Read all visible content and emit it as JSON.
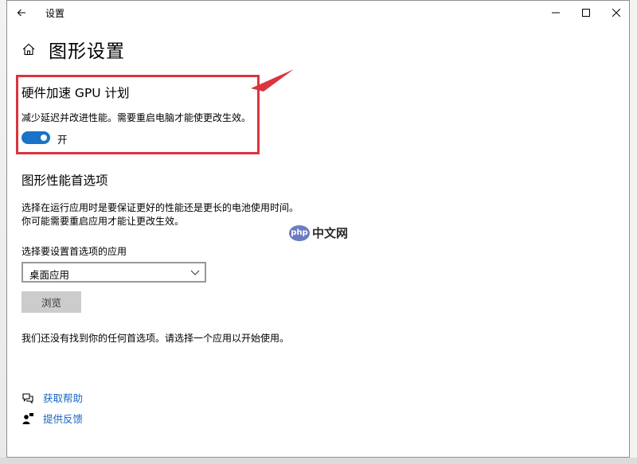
{
  "window": {
    "title": "设置"
  },
  "page": {
    "title": "图形设置"
  },
  "gpu_scheduling": {
    "heading": "硬件加速 GPU 计划",
    "description": "减少延迟并改进性能。需要重启电脑才能使更改生效。",
    "toggle_on": true,
    "toggle_label": "开"
  },
  "graphics_pref": {
    "heading": "图形性能首选项",
    "description_line1": "选择在运行应用时是要保证更好的性能还是更长的电池使用时间。",
    "description_line2": "你可能需要重启应用才能让更改生效。",
    "dropdown_label": "选择要设置首选项的应用",
    "dropdown_value": "桌面应用",
    "browse_label": "浏览",
    "empty_message": "我们还没有找到你的任何首选项。请选择一个应用以开始使用。"
  },
  "links": {
    "help": "获取帮助",
    "feedback": "提供反馈"
  },
  "watermark": {
    "badge": "php",
    "text": "中文网"
  },
  "icons": {
    "back": "back-arrow-icon",
    "minimize": "minimize-icon",
    "maximize": "maximize-icon",
    "close": "close-icon",
    "home": "home-icon",
    "dropdown": "chevron-down-icon",
    "help": "help-chat-icon",
    "feedback": "feedback-person-icon"
  },
  "colors": {
    "accent": "#1a73c7",
    "link": "#1a66c2",
    "highlight": "#d9353f"
  }
}
